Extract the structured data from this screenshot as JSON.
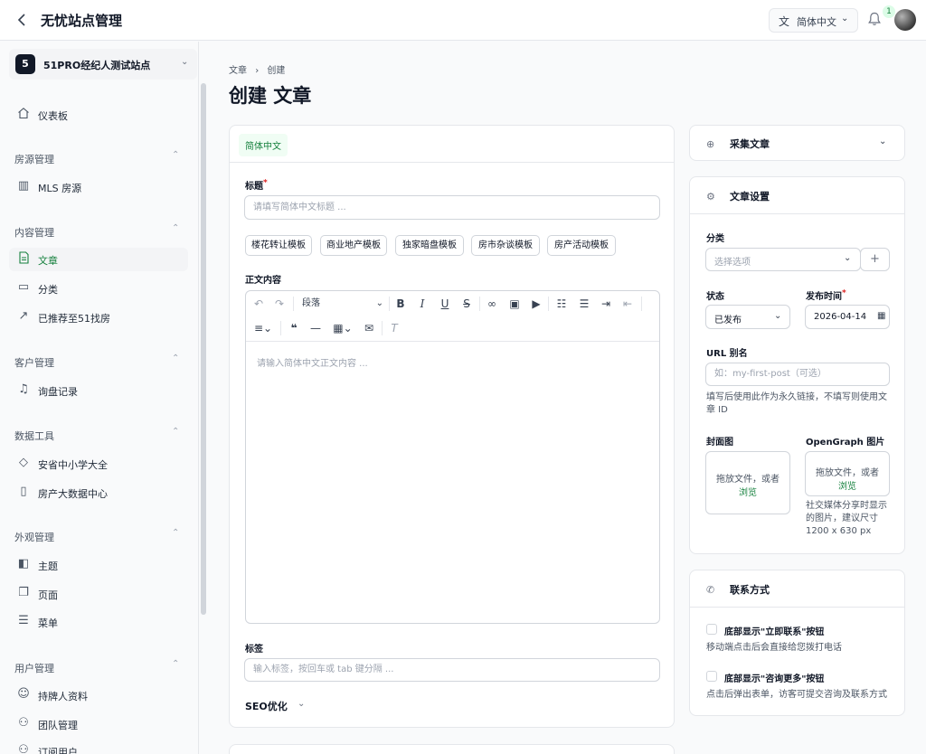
{
  "header": {
    "back_icon": "chevron-left-icon",
    "title": "无忧站点管理",
    "language": "简体中文",
    "notification_count": "1"
  },
  "sidebar": {
    "site": {
      "badge": "5",
      "name": "51PRO经纪人测试站点"
    },
    "dashboard": "仪表板",
    "groups": [
      {
        "title": "房源管理",
        "items": [
          "MLS 房源"
        ]
      },
      {
        "title": "内容管理",
        "items": [
          "文章",
          "分类",
          "已推荐至51找房"
        ]
      },
      {
        "title": "客户管理",
        "items": [
          "询盘记录"
        ]
      },
      {
        "title": "数据工具",
        "items": [
          "安省中小学大全",
          "房产大数据中心"
        ]
      },
      {
        "title": "外观管理",
        "items": [
          "主题",
          "页面",
          "菜单"
        ]
      },
      {
        "title": "用户管理",
        "items": [
          "持牌人资料",
          "团队管理",
          "订阅用户"
        ]
      }
    ]
  },
  "breadcrumb": {
    "parent": "文章",
    "separator": "›",
    "current": "创建"
  },
  "page_title": "创建 文章",
  "editor_card": {
    "lang_tab": "简体中文",
    "title_label": "标题",
    "required_mark": "*",
    "title_placeholder": "请填写简体中文标题 ...",
    "templates": [
      "楼花转让模板",
      "商业地产模板",
      "独家暗盘模板",
      "房市杂谈模板",
      "房产活动模板"
    ],
    "content_label": "正文内容",
    "paragraph_select": "段落",
    "content_placeholder": "请输入简体中文正文内容 ...",
    "tags_label": "标签",
    "tags_placeholder": "输入标签，按回车或 tab 键分隔 ...",
    "seo_label": "SEO优化"
  },
  "collect_card": {
    "title": "采集文章"
  },
  "settings_card": {
    "title": "文章设置",
    "category_label": "分类",
    "category_placeholder": "选择选项",
    "status_label": "状态",
    "status_value": "已发布",
    "publish_label": "发布时间",
    "publish_value": "2026-04-14",
    "slug_label": "URL 别名",
    "slug_placeholder": "如：my-first-post（可选）",
    "slug_help_line1": "填写后使用此作为永久链接，不填写则使用文",
    "slug_help_line2": "章 ID",
    "cover_label": "封面图",
    "og_label": "OpenGraph 图片",
    "upload_text": "拖放文件，或者",
    "upload_link": "浏览",
    "og_help_line1": "社交媒体分享时显示",
    "og_help_line2": "的图片，建议尺寸",
    "og_help_line3": "1200 x 630 px"
  },
  "contact_card": {
    "title": "联系方式",
    "option1_label": "底部显示\"立即联系\"按钮",
    "option1_help": "移动端点击后会直接给您拨打电话",
    "option2_label": "底部显示\"咨询更多\"按钮",
    "option2_help": "点击后弹出表单，访客可提交咨询及联系方式"
  },
  "colors": {
    "accent": "#15803d",
    "accent_bg": "#f0fdf4",
    "border": "#e5e7eb"
  }
}
